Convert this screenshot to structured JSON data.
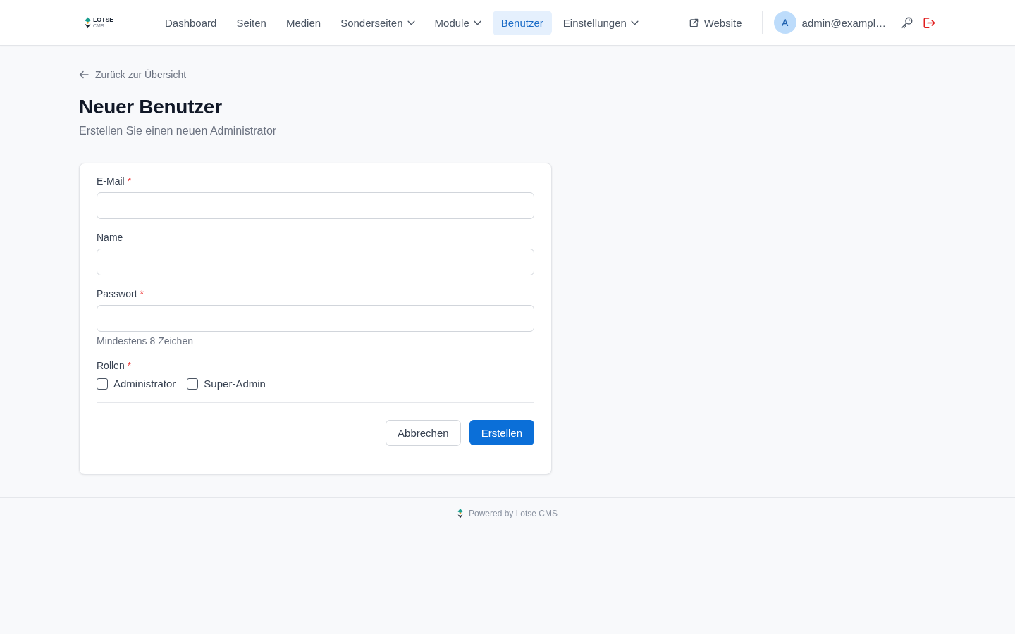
{
  "header": {
    "logo": {
      "name": "LOTSE",
      "sub": "CMS"
    },
    "nav": [
      {
        "label": "Dashboard",
        "selected": false,
        "has_menu": false
      },
      {
        "label": "Seiten",
        "selected": false,
        "has_menu": false
      },
      {
        "label": "Medien",
        "selected": false,
        "has_menu": false
      },
      {
        "label": "Sonderseiten",
        "selected": false,
        "has_menu": true
      },
      {
        "label": "Module",
        "selected": false,
        "has_menu": true
      },
      {
        "label": "Benutzer",
        "selected": true,
        "has_menu": false
      },
      {
        "label": "Einstellungen",
        "selected": false,
        "has_menu": true
      }
    ],
    "website_link": "Website",
    "user": {
      "initial": "A",
      "email": "admin@exampl…"
    }
  },
  "back_link": "Zurück zur Übersicht",
  "page": {
    "title": "Neuer Benutzer",
    "subtitle": "Erstellen Sie einen neuen Administrator"
  },
  "form": {
    "fields": [
      {
        "label": "E-Mail",
        "required_mark": "*"
      },
      {
        "label": "Name"
      },
      {
        "label": "Passwort",
        "required_mark": "*",
        "hint": "Mindestens 8 Zeichen"
      }
    ],
    "roles": {
      "label": "Rollen",
      "required_mark": "*",
      "options": [
        {
          "label": "Administrator",
          "checked": false
        },
        {
          "label": "Super-Admin",
          "checked": false
        }
      ]
    },
    "buttons": [
      {
        "label": "Abbrechen",
        "kind": "secondary"
      },
      {
        "label": "Erstellen",
        "kind": "primary"
      }
    ]
  },
  "footer": {
    "text": "Powered by Lotse CMS"
  }
}
